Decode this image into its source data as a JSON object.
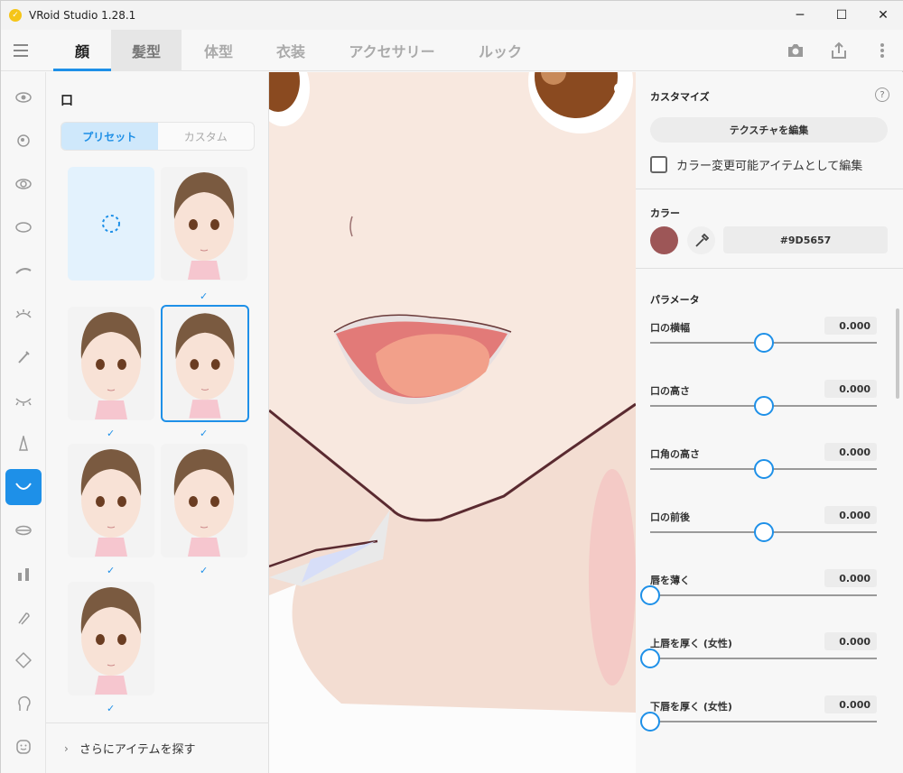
{
  "app": {
    "title": "VRoid Studio 1.28.1",
    "logo_glyph": "✓"
  },
  "window_controls": {
    "minimize": "─",
    "maximize": "☐",
    "close": "✕"
  },
  "tabs": [
    {
      "label": "顔"
    },
    {
      "label": "髪型"
    },
    {
      "label": "体型"
    },
    {
      "label": "衣装"
    },
    {
      "label": "アクセサリー"
    },
    {
      "label": "ルック"
    }
  ],
  "toolbar_icons": [
    "camera-icon",
    "export-icon",
    "more-vertical-icon"
  ],
  "rail_icons": [
    "eye-icon",
    "iris-icon",
    "eye-highlight-icon",
    "eye-white-icon",
    "eyebrow-icon",
    "eyelash-icon",
    "eyeliner-icon",
    "eyelid-icon",
    "nose-icon",
    "mouth-icon",
    "teeth-icon",
    "lipstick-icon",
    "ear-icon",
    "face-contour-icon",
    "head-icon",
    "face-icon"
  ],
  "active_rail_index": 9,
  "panel": {
    "title": "口",
    "segment": {
      "preset": "プリセット",
      "custom": "カスタム"
    },
    "check_glyph": "✓",
    "more_label": "さらにアイテムを探す",
    "more_chevron": "›"
  },
  "right": {
    "customize_title": "カスタマイズ",
    "help_glyph": "?",
    "edit_texture": "テクスチャを編集",
    "color_editable_label": "カラー変更可能アイテムとして編集",
    "color_title": "カラー",
    "color_hex": "#9D5657",
    "color_value": "#9D5657",
    "params_title": "パラメータ",
    "params": [
      {
        "label": "口の横幅",
        "value": "0.000",
        "level": 0.5
      },
      {
        "label": "口の高さ",
        "value": "0.000",
        "level": 0.5
      },
      {
        "label": "口角の高さ",
        "value": "0.000",
        "level": 0.5
      },
      {
        "label": "口の前後",
        "value": "0.000",
        "level": 0.5
      },
      {
        "label": "唇を薄く",
        "value": "0.000",
        "level": 0.0
      },
      {
        "label": "上唇を厚く (女性)",
        "value": "0.000",
        "level": 0.0
      },
      {
        "label": "下唇を厚く (女性)",
        "value": "0.000",
        "level": 0.0
      }
    ]
  },
  "colors": {
    "accent": "#1e90e8",
    "skin": "#f8e8df",
    "hair": "#7a5a40",
    "lip_outline": "#5a2a30"
  }
}
